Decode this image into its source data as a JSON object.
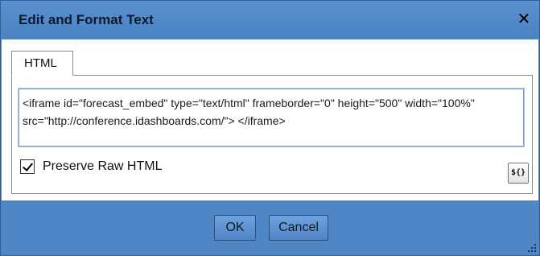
{
  "dialog": {
    "title": "Edit and Format Text",
    "close_glyph": "✕"
  },
  "tabs": [
    {
      "label": "HTML",
      "active": true
    }
  ],
  "editor": {
    "content": "<iframe id=\"forecast_embed\" type=\"text/html\" frameborder=\"0\" height=\"500\" width=\"100%\" src=\"http://conference.idashboards.com/\"> </iframe>"
  },
  "options": {
    "preserve_raw_html_label": "Preserve Raw HTML",
    "preserve_raw_html_checked": true,
    "variable_button_label": "${}"
  },
  "footer": {
    "ok_label": "OK",
    "cancel_label": "Cancel"
  },
  "colors": {
    "chrome_blue": "#4f86c6",
    "button_blue": "#6fa2dc",
    "panel_white": "#ffffff"
  },
  "icons": {
    "close": "close-icon",
    "checkbox": "checkmark-icon",
    "variable": "variable-insert-icon",
    "resize": "resize-grip-icon"
  }
}
